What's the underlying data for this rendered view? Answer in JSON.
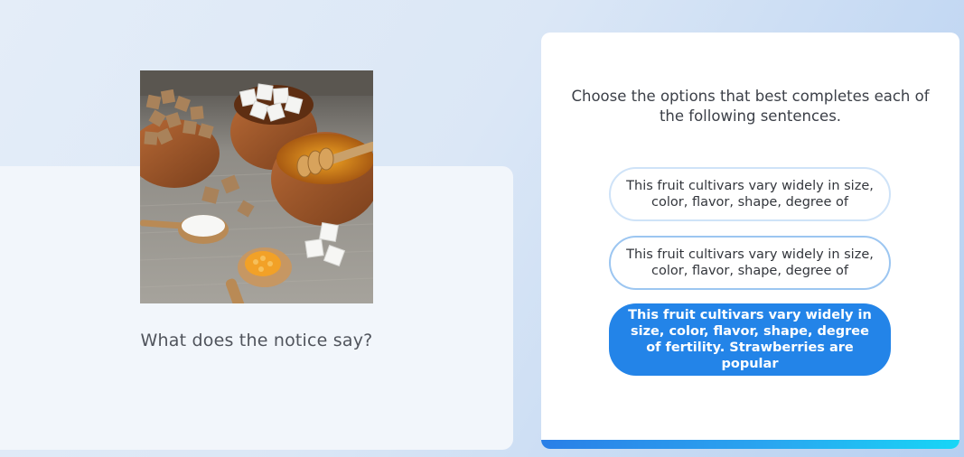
{
  "question": {
    "text": "What does the notice say?"
  },
  "answer_panel": {
    "instructions": "Choose the options that best completes each of the following sentences.",
    "options": [
      {
        "label": "This fruit cultivars vary widely in size, color, flavor, shape, degree of",
        "state": "unselected"
      },
      {
        "label": "This fruit cultivars vary widely in size, color, flavor, shape, degree of",
        "state": "unselected-focused"
      },
      {
        "label": "This fruit cultivars vary widely in size, color, flavor, shape, degree of fertility. Strawberries are popular",
        "state": "selected"
      }
    ]
  },
  "theme": {
    "accent": "#2384e8",
    "option_border": "#cfe3f8",
    "progress_start": "#2a7fe7",
    "progress_end": "#17d6f6"
  }
}
